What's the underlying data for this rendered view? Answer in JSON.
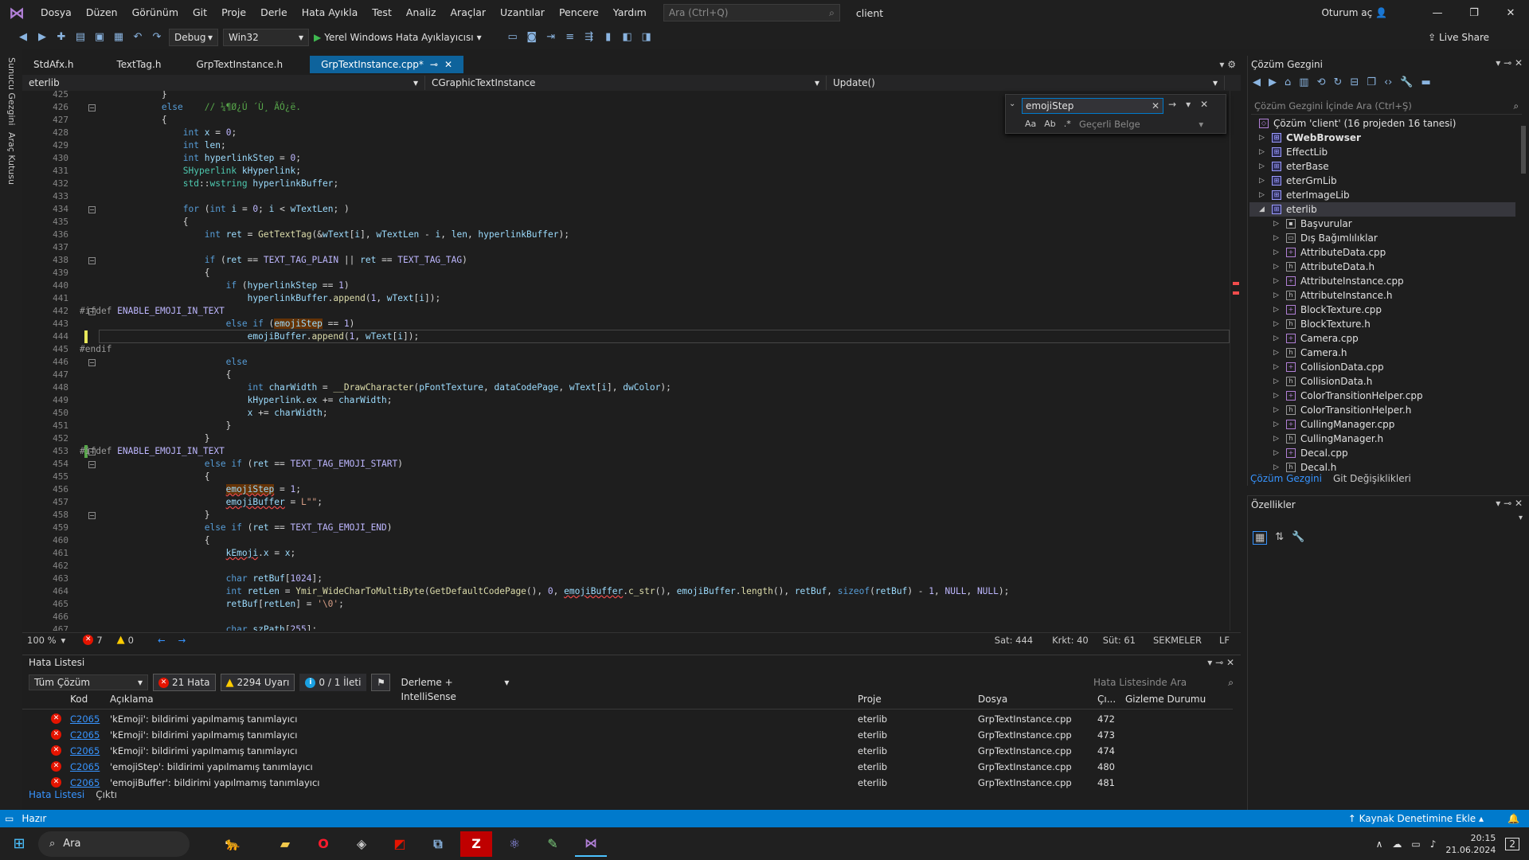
{
  "menubar": {
    "items": [
      "Dosya",
      "Düzen",
      "Görünüm",
      "Git",
      "Proje",
      "Derle",
      "Hata Ayıkla",
      "Test",
      "Analiz",
      "Araçlar",
      "Uzantılar",
      "Pencere",
      "Yardım"
    ],
    "search_placeholder": "Ara (Ctrl+Q)",
    "solution_name": "client",
    "sign_in": "Oturum aç"
  },
  "toolbar": {
    "config": "Debug",
    "platform": "Win32",
    "run_target": "Yerel Windows Hata Ayıklayıcısı",
    "live_share": "Live Share"
  },
  "left_strip": [
    "Sunucu Gezgini",
    "Araç Kutusu"
  ],
  "doc_tabs": [
    "StdAfx.h",
    "TextTag.h",
    "GrpTextInstance.h",
    "GrpTextInstance.cpp*"
  ],
  "navbar": {
    "project": "eterlib",
    "class": "CGraphicTextInstance",
    "member": "Update()"
  },
  "find": {
    "value": "emojiStep",
    "opt_case": "Aa",
    "opt_word": "Ab",
    "scope": "Geçerli Belge"
  },
  "code": {
    "line_numbers": [
      "425",
      "426",
      "427",
      "428",
      "429",
      "430",
      "431",
      "432",
      "433",
      "434",
      "435",
      "436",
      "437",
      "438",
      "439",
      "440",
      "441",
      "442",
      "443",
      "444",
      "445",
      "446",
      "447",
      "448",
      "449",
      "450",
      "451",
      "452",
      "453",
      "454",
      "455",
      "456",
      "457",
      "458",
      "459",
      "460",
      "461",
      "462",
      "463",
      "464",
      "465",
      "466",
      "467"
    ]
  },
  "editor_status": {
    "zoom": "100 %",
    "errors": "7",
    "warnings": "0",
    "line": "Sat: 444",
    "char": "Krkt: 40",
    "col": "Süt: 61",
    "tabs": "SEKMELER",
    "eol": "LF"
  },
  "error_list": {
    "title": "Hata Listesi",
    "scope": "Tüm Çözüm",
    "errors_btn": "21 Hata",
    "warnings_btn": "2294 Uyarı",
    "messages_btn": "0 / 1 İleti",
    "build_filter": "Derleme + IntelliSense",
    "search_placeholder": "Hata Listesinde Ara",
    "columns": [
      "Kod",
      "Açıklama",
      "Proje",
      "Dosya",
      "Çı...",
      "Gizleme Durumu"
    ],
    "rows": [
      {
        "code": "C2065",
        "desc": "'kEmoji': bildirimi yapılmamış tanımlayıcı",
        "project": "eterlib",
        "file": "GrpTextInstance.cpp",
        "line": "472"
      },
      {
        "code": "C2065",
        "desc": "'kEmoji': bildirimi yapılmamış tanımlayıcı",
        "project": "eterlib",
        "file": "GrpTextInstance.cpp",
        "line": "473"
      },
      {
        "code": "C2065",
        "desc": "'kEmoji': bildirimi yapılmamış tanımlayıcı",
        "project": "eterlib",
        "file": "GrpTextInstance.cpp",
        "line": "474"
      },
      {
        "code": "C2065",
        "desc": "'emojiStep': bildirimi yapılmamış tanımlayıcı",
        "project": "eterlib",
        "file": "GrpTextInstance.cpp",
        "line": "480"
      },
      {
        "code": "C2065",
        "desc": "'emojiBuffer': bildirimi yapılmamış tanımlayıcı",
        "project": "eterlib",
        "file": "GrpTextInstance.cpp",
        "line": "481"
      }
    ],
    "tabs": [
      "Hata Listesi",
      "Çıktı"
    ]
  },
  "solution_explorer": {
    "title": "Çözüm Gezgini",
    "search_placeholder": "Çözüm Gezgini İçinde Ara (Ctrl+Ş)",
    "root": "Çözüm 'client' (16 projeden 16 tanesi)",
    "projects": [
      "CWebBrowser",
      "EffectLib",
      "eterBase",
      "eterGrnLib",
      "eterImageLib",
      "eterlib"
    ],
    "children": [
      "Başvurular",
      "Dış Bağımlılıklar",
      "AttributeData.cpp",
      "AttributeData.h",
      "AttributeInstance.cpp",
      "AttributeInstance.h",
      "BlockTexture.cpp",
      "BlockTexture.h",
      "Camera.cpp",
      "Camera.h",
      "CollisionData.cpp",
      "CollisionData.h",
      "ColorTransitionHelper.cpp",
      "ColorTransitionHelper.h",
      "CullingManager.cpp",
      "CullingManager.h",
      "Decal.cpp",
      "Decal.h"
    ],
    "tabs": [
      "Çözüm Gezgini",
      "Git Değişiklikleri"
    ]
  },
  "properties": {
    "title": "Özellikler"
  },
  "statusbar": {
    "ready": "Hazır",
    "source_control": "Kaynak Denetimine Ekle"
  },
  "taskbar": {
    "search": "Ara",
    "time": "20:15",
    "date": "21.06.2024",
    "notifications": "2"
  }
}
